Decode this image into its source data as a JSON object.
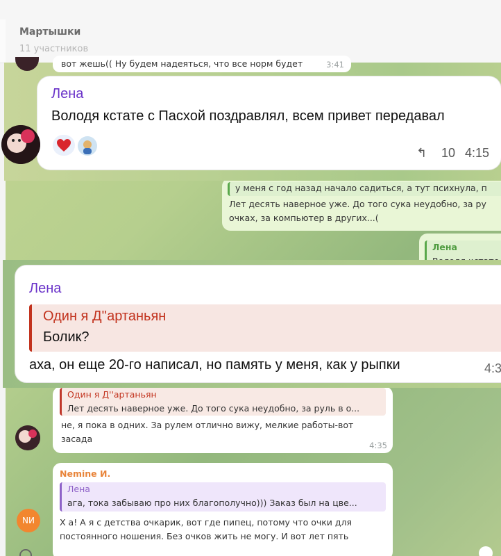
{
  "header": {
    "title": "Мартышки",
    "subtitle": "11 участников"
  },
  "messages": {
    "top_partial": {
      "text": "вот жешь(( Ну будем надеяться, что все норм будет",
      "time": "3:41"
    },
    "lena_main": {
      "sender": "Лена",
      "text": "Володя кстате с Пасхой поздравлял, всем привет передавал",
      "replies": "10",
      "time": "4:15"
    },
    "out1": {
      "line1": "у меня с год назад начало садиться, а тут психнула, п",
      "line2": "Лет десять наверное уже. До того сука неудобно, за ру",
      "line3": "очках, за компьютер в других...("
    },
    "out2": {
      "quote_name": "Лена",
      "quote_text": "Володя кстате"
    },
    "lena_zoom": {
      "sender": "Лена",
      "quote_name": "Один я Д''артаньян",
      "quote_text": "Болик?",
      "text": "аха, он еще 20-го написал, но память у меня, как у рыпки",
      "time": "4:3"
    },
    "reply_msg": {
      "quote_name": "Один я Д''артаньян",
      "quote_text": "Лет десять наверное уже. До того сука неудобно, за руль в о...",
      "text_line1": "не, я пока в одних. За рулем отлично вижу, мелкие работы-вот",
      "text_line2": "засада",
      "time": "4:35"
    },
    "nemine": {
      "sender": "Nemine И.",
      "avatar_initials": "NИ",
      "quote_name": "Лена",
      "quote_text": "ага, тока забываю про них благополучно))) Заказ был на цве...",
      "line1": "Х а! А я с детства очкарик, вот где пипец, потому что очки для",
      "line2": "постоянного ношения. Без очков жить не могу. И вот лет пять"
    }
  },
  "colors": {
    "accent_name": "#6a33c9",
    "quote_red": "#c2331e",
    "nemine_orange": "#e8843a"
  }
}
